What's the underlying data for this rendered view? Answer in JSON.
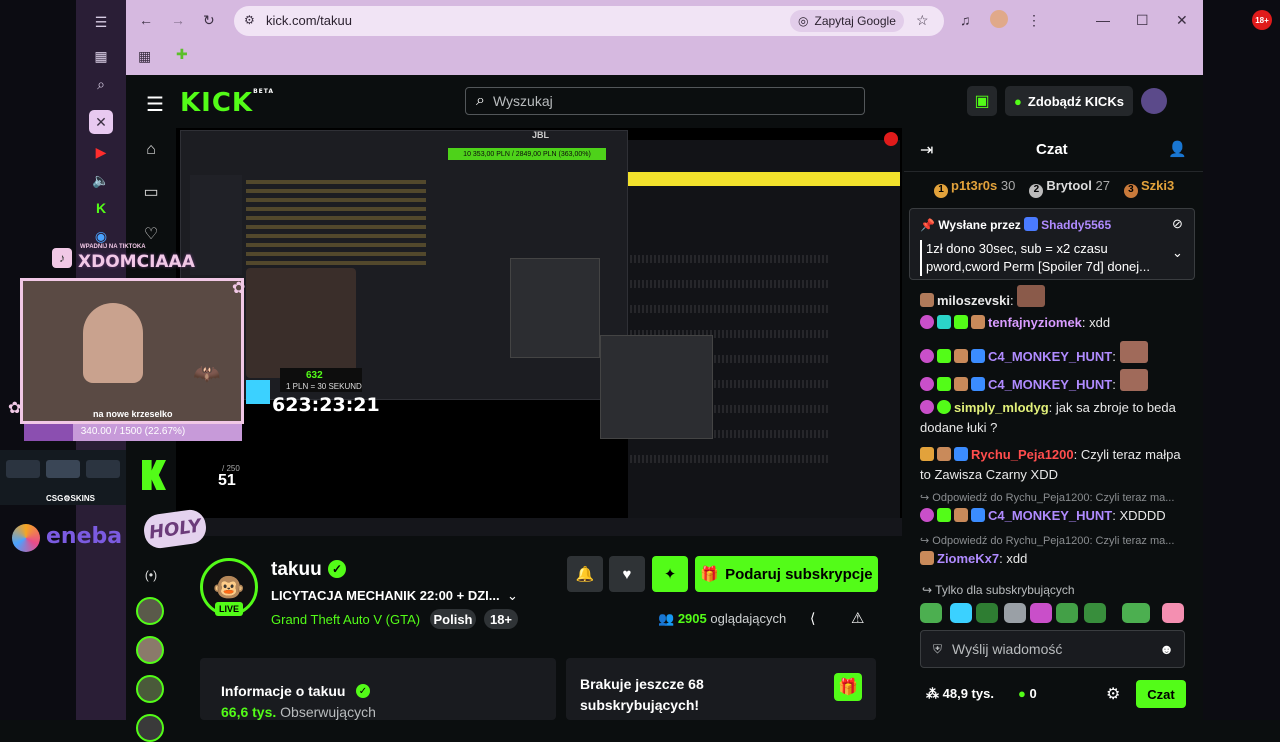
{
  "browser": {
    "url": "kick.com/takuu",
    "ask_google": "Zapytaj Google",
    "age_badge": "18+"
  },
  "header": {
    "search_placeholder": "Wyszukaj",
    "get_kicks": "Zdobądź KICKs",
    "logo": "KICK",
    "logo_sup": "BETA"
  },
  "video": {
    "timer": "623:23:21",
    "goal_bar": "10 353,00 PLN / 2849,00 PLN (363,00%)",
    "jbl": "JBL",
    "pln_line": "1 PLN = 30 SEKUND",
    "pln_count": "632"
  },
  "overlay": {
    "cam_tag_small": "WPADNIJ NA TIKTOKA",
    "cam_name": "XDOMCIAAA",
    "cam_caption": "na nowe krzeselko",
    "goal_text": "340.00 / 1500 (22.67%)",
    "csgo": "CSG⚙SKINS",
    "eneba": "eneba",
    "holy": "HOLY",
    "count_small": "/ 250",
    "count_big": "51"
  },
  "channel": {
    "name": "takuu",
    "live": "LIVE",
    "title": "LICYTACJA MECHANIK 22:00 + DZI...",
    "game": "Grand Theft Auto V (GTA)",
    "tags": [
      "Polish",
      "18+"
    ],
    "viewers_num": "2905",
    "viewers_label": "oglądających",
    "sub_button": "Podaruj subskrypcje"
  },
  "cards": {
    "info_title": "Informacje o takuu",
    "followers_num": "66,6 tys.",
    "followers_label": "Obserwujących",
    "subs_needed": "Brakuje jeszcze 68",
    "subs_needed2": "subskrybujących!"
  },
  "chat": {
    "title": "Czat",
    "leaders": [
      {
        "rank": "1",
        "name": "p1t3r0s",
        "value": "30"
      },
      {
        "rank": "2",
        "name": "Brytool",
        "value": "27"
      },
      {
        "rank": "3",
        "name": "Szki3",
        "value": ""
      }
    ],
    "pinned_by": "Wysłane przez",
    "pinned_user": "Shaddy5565",
    "pinned_line1": "1zł dono 30sec, sub = x2 czasu",
    "pinned_line2": "pword,cword Perm [Spoiler 7d] donej...",
    "messages": [
      {
        "user": "miloszevski",
        "text": "",
        "color": "#ffffff"
      },
      {
        "user": "tenfajnyziomek",
        "text": ": xdd",
        "color": "#d99cff"
      },
      {
        "user": "C4_MONKEY_HUNT",
        "text": ":",
        "color": "#b08bff"
      },
      {
        "user": "C4_MONKEY_HUNT",
        "text": ":",
        "color": "#b08bff"
      },
      {
        "user": "simply_mlodyg",
        "text": ": jak sa zbroje to beda dodane łuki ?",
        "color": "#e2f07a"
      },
      {
        "user": "Rychu_Peja1200",
        "text": ": Czyli teraz małpa to Zawisza Czarny XDD",
        "color": "#ff4d4d"
      },
      {
        "reply": "Odpowiedź do Rychu_Peja1200: Czyli teraz ma...",
        "user": "C4_MONKEY_HUNT",
        "text": ": XDDDD",
        "color": "#b08bff"
      },
      {
        "reply": "Odpowiedź do Rychu_Peja1200: Czyli teraz ma...",
        "user": "ZiomeKx7",
        "text": ": xdd",
        "color": "#b08bff"
      }
    ],
    "sub_only": "Tylko dla subskrybujących",
    "input_placeholder": "Wyślij wiadomość",
    "footer_viewers": "48,9 tys.",
    "footer_kicks": "0",
    "send": "Czat"
  }
}
